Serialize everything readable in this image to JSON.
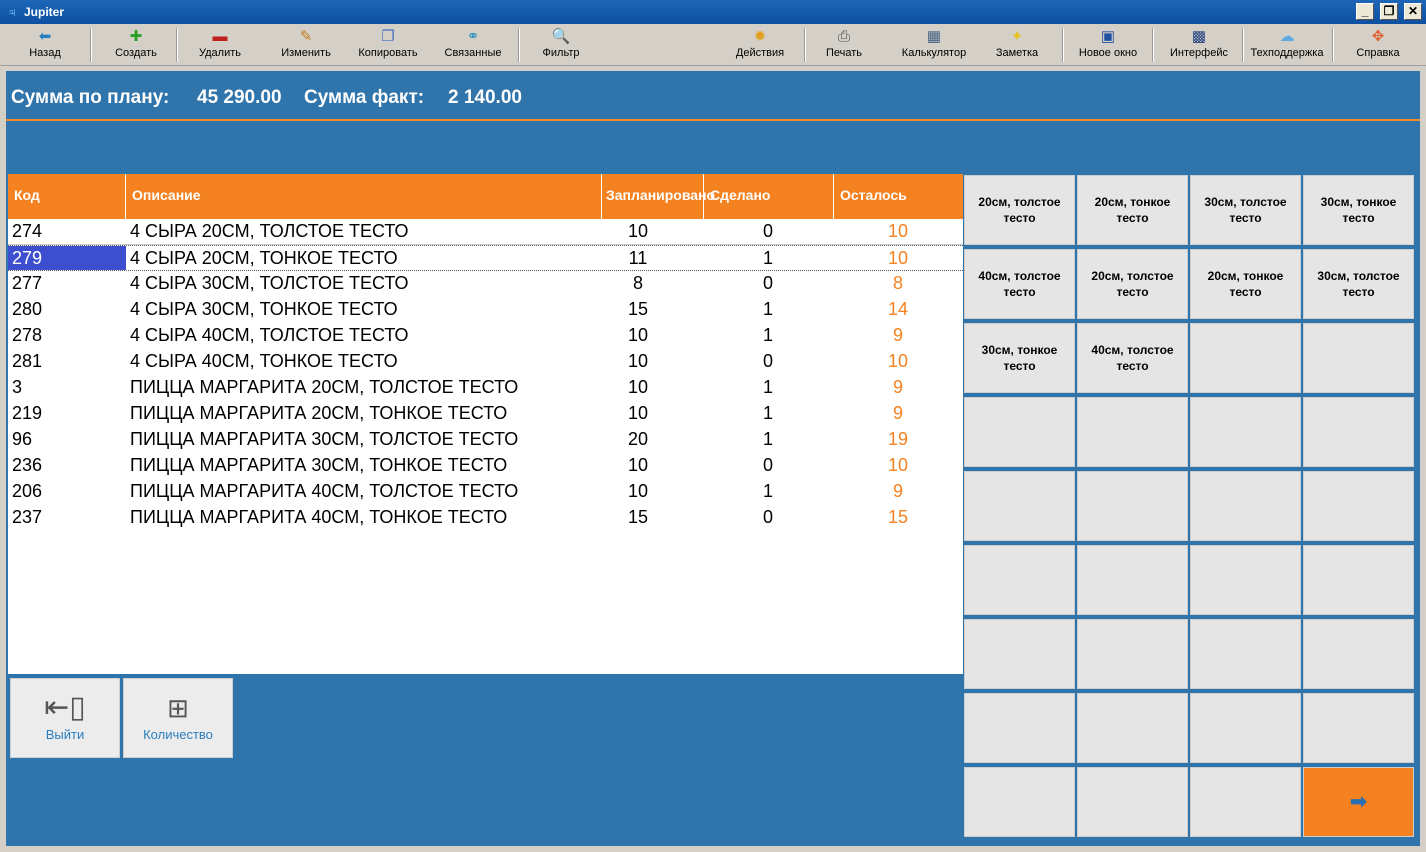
{
  "window": {
    "title": "Jupiter",
    "app_icon": "jupiter-icon"
  },
  "toolbar": [
    {
      "label": "Назад",
      "icon": "back-arrow-icon",
      "glyph": "⬅",
      "color": "#2a7fc0"
    },
    {
      "label": "Создать",
      "icon": "plus-icon",
      "glyph": "✚",
      "color": "#2aa02a"
    },
    {
      "label": "Удалить",
      "icon": "minus-icon",
      "glyph": "▬",
      "color": "#c02020"
    },
    {
      "label": "Изменить",
      "icon": "pencil-icon",
      "glyph": "✎",
      "color": "#c08020"
    },
    {
      "label": "Копировать",
      "icon": "copy-icon",
      "glyph": "❐",
      "color": "#4070c0"
    },
    {
      "label": "Связанные",
      "icon": "link-icon",
      "glyph": "⚭",
      "color": "#2a90c0"
    },
    {
      "label": "Фильтр",
      "icon": "magnifier-icon",
      "glyph": "🔍",
      "color": "#3060a0"
    },
    {
      "label": "Действия",
      "icon": "gear-icon",
      "glyph": "✹",
      "color": "#e0a020"
    },
    {
      "label": "Печать",
      "icon": "printer-icon",
      "glyph": "⎙",
      "color": "#555555"
    },
    {
      "label": "Калькулятор",
      "icon": "calculator-icon",
      "glyph": "▦",
      "color": "#406080"
    },
    {
      "label": "Заметка",
      "icon": "bulb-icon",
      "glyph": "✦",
      "color": "#e8c020"
    },
    {
      "label": "Новое окно",
      "icon": "new-window-icon",
      "glyph": "▣",
      "color": "#2050a0"
    },
    {
      "label": "Интерфейс",
      "icon": "interface-icon",
      "glyph": "▩",
      "color": "#204080"
    },
    {
      "label": "Техподдержка",
      "icon": "support-icon",
      "glyph": "☁",
      "color": "#60a8e0"
    },
    {
      "label": "Справка",
      "icon": "help-icon",
      "glyph": "✥",
      "color": "#e06030"
    }
  ],
  "summary": {
    "plan_label": "Сумма по плану:",
    "plan_value": "45 290.00",
    "fact_label": "Сумма факт:",
    "fact_value": "2 140.00"
  },
  "table": {
    "columns": [
      "Код",
      "Описание",
      "Запланировано",
      "Сделано",
      "Осталось"
    ],
    "selected_index": 1,
    "rows": [
      {
        "code": "274",
        "desc": "4 СЫРА 20СМ, ТОЛСТОЕ ТЕСТО",
        "plan": "10",
        "done": "0",
        "left": "10"
      },
      {
        "code": "279",
        "desc": "4 СЫРА 20СМ, ТОНКОЕ ТЕСТО",
        "plan": "11",
        "done": "1",
        "left": "10"
      },
      {
        "code": "277",
        "desc": "4 СЫРА 30СМ, ТОЛСТОЕ ТЕСТО",
        "plan": "8",
        "done": "0",
        "left": "8"
      },
      {
        "code": "280",
        "desc": "4 СЫРА 30СМ, ТОНКОЕ ТЕСТО",
        "plan": "15",
        "done": "1",
        "left": "14"
      },
      {
        "code": "278",
        "desc": "4 СЫРА 40СМ, ТОЛСТОЕ ТЕСТО",
        "plan": "10",
        "done": "1",
        "left": "9"
      },
      {
        "code": "281",
        "desc": "4 СЫРА 40СМ, ТОНКОЕ ТЕСТО",
        "plan": "10",
        "done": "0",
        "left": "10"
      },
      {
        "code": "3",
        "desc": "ПИЦЦА МАРГАРИТА 20СМ, ТОЛСТОЕ ТЕСТО",
        "plan": "10",
        "done": "1",
        "left": "9"
      },
      {
        "code": "219",
        "desc": "ПИЦЦА МАРГАРИТА 20СМ, ТОНКОЕ ТЕСТО",
        "plan": "10",
        "done": "1",
        "left": "9"
      },
      {
        "code": "96",
        "desc": "ПИЦЦА МАРГАРИТА 30СМ, ТОЛСТОЕ ТЕСТО",
        "plan": "20",
        "done": "1",
        "left": "19"
      },
      {
        "code": "236",
        "desc": "ПИЦЦА МАРГАРИТА 30СМ, ТОНКОЕ ТЕСТО",
        "plan": "10",
        "done": "0",
        "left": "10"
      },
      {
        "code": "206",
        "desc": "ПИЦЦА МАРГАРИТА 40СМ, ТОЛСТОЕ ТЕСТО",
        "plan": "10",
        "done": "1",
        "left": "9"
      },
      {
        "code": "237",
        "desc": "ПИЦЦА МАРГАРИТА 40СМ, ТОНКОЕ ТЕСТО",
        "plan": "15",
        "done": "0",
        "left": "15"
      }
    ]
  },
  "actions": {
    "exit_label": "Выйти",
    "exit_icon": "exit-door-icon",
    "quantity_label": "Количество",
    "quantity_icon": "calculator-icon"
  },
  "grid": {
    "buttons": [
      "20см, толстое тесто",
      "20см, тонкое тесто",
      "30см, толстое тесто",
      "30см, тонкое тесто",
      "40см, толстое тесто",
      "20см, толстое тесто",
      "20см, тонкое тесто",
      "30см, толстое тесто",
      "30см, тонкое тесто",
      "40см, толстое тесто",
      "",
      "",
      "",
      "",
      "",
      "",
      "",
      "",
      "",
      "",
      "",
      "",
      "",
      "",
      "",
      "",
      "",
      "",
      "",
      "",
      "",
      "",
      "",
      "",
      "",
      ""
    ],
    "next_icon": "arrow-right-icon",
    "next_glyph": "➡"
  },
  "colors": {
    "accent": "#f58220",
    "background": "#2f74aa",
    "selection": "#3d4fcf"
  }
}
